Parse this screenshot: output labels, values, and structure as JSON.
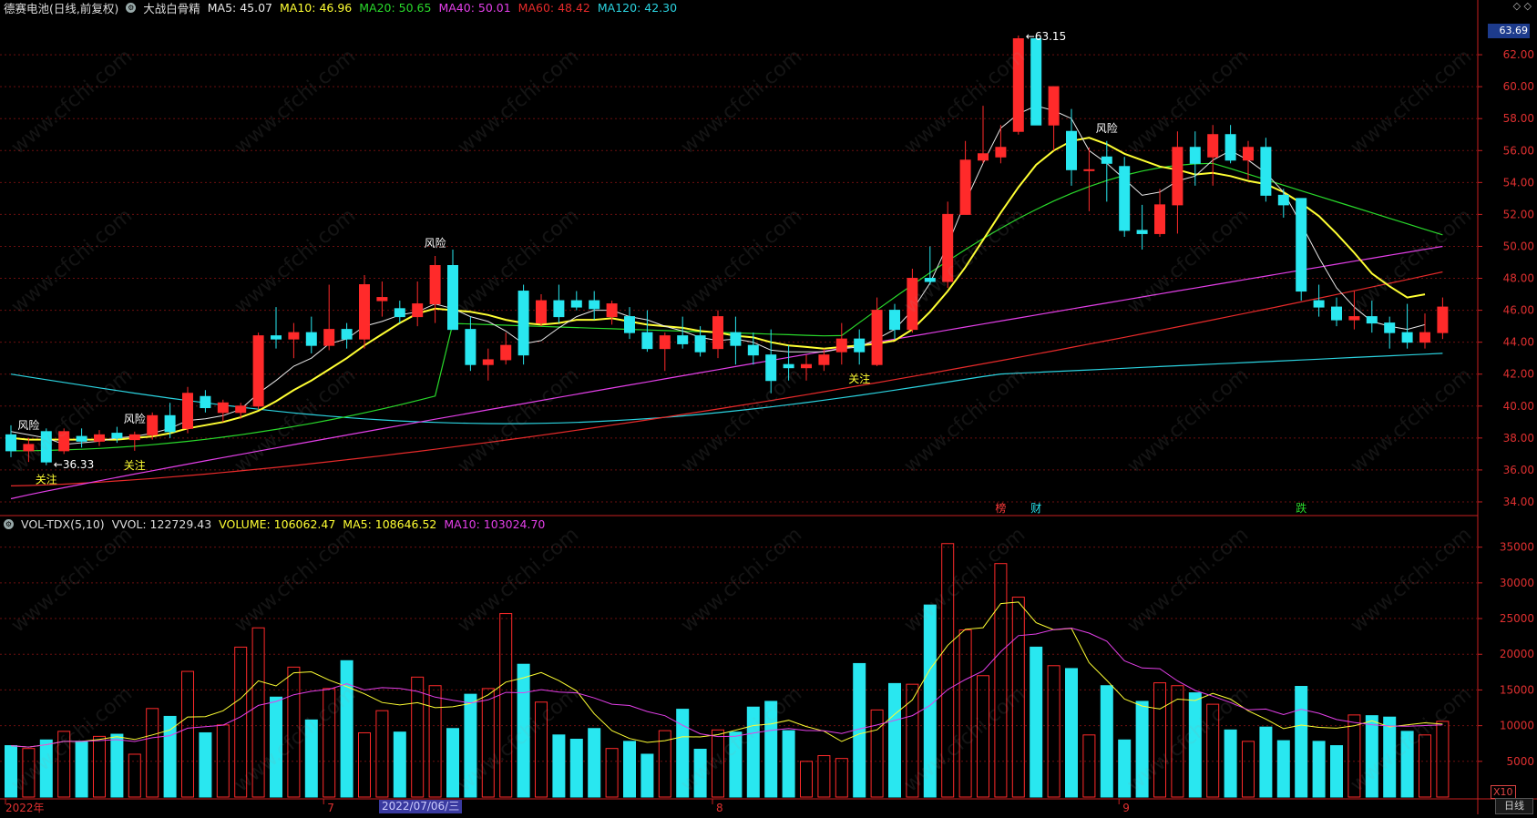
{
  "header": {
    "stock": "德赛电池(日线,前复权)",
    "indicator": "大战白骨精",
    "ma5": "MA5: 45.07",
    "ma10": "MA10: 46.96",
    "ma20": "MA20: 50.65",
    "ma40": "MA40: 50.01",
    "ma60": "MA60: 48.42",
    "ma120": "MA120: 42.30"
  },
  "vol_header": {
    "name": "VOL-TDX(5,10)",
    "vvol": "VVOL: 122729.43",
    "volume": "VOLUME: 106062.47",
    "ma5": "MA5: 108646.52",
    "ma10": "MA10: 103024.70"
  },
  "colors": {
    "up": "#ff2a2a",
    "down": "#29e7f0",
    "ma5": "#e8e8e8",
    "ma10": "#ffff33",
    "ma20": "#29d92b",
    "ma40": "#e33fe8",
    "ma60": "#e62a2a",
    "ma120": "#2bd3e0",
    "grid": "#6b0f0f",
    "axis": "#c82020",
    "signal_risk": "#ffffff",
    "signal_focus": "#ffff33"
  },
  "price_tag": "63.69",
  "timeframe": "日线",
  "vol_scale_note": "X10",
  "selected_date": "2022/07/06/三",
  "corner_icons": "◇ ◇",
  "chart_data": {
    "type": "candlestick",
    "price_axis": {
      "ticks": [
        34,
        36,
        38,
        40,
        42,
        44,
        46,
        48,
        50,
        52,
        54,
        56,
        58,
        60,
        62
      ],
      "labels": [
        "34.00",
        "36.00",
        "38.00",
        "40.00",
        "42.00",
        "44.00",
        "46.00",
        "48.00",
        "50.00",
        "52.00",
        "54.00",
        "56.00",
        "58.00",
        "60.00",
        "62.00"
      ],
      "range": [
        33.2,
        64.4
      ]
    },
    "vol_axis": {
      "ticks": [
        5000,
        10000,
        15000,
        20000,
        25000,
        30000,
        35000
      ],
      "range": [
        0,
        37000
      ]
    },
    "x_labels": [
      {
        "i": 0,
        "text": "2022年"
      },
      {
        "i": 18,
        "text": "7"
      },
      {
        "i": 40,
        "text": "8"
      },
      {
        "i": 63,
        "text": "9"
      }
    ],
    "candles": [
      [
        38.2,
        38.8,
        36.8,
        37.2,
        7200
      ],
      [
        37.2,
        38.0,
        36.5,
        37.6,
        6800
      ],
      [
        38.4,
        38.6,
        36.3,
        36.5,
        8000
      ],
      [
        37.2,
        38.6,
        37.0,
        38.4,
        9200
      ],
      [
        38.1,
        38.6,
        37.4,
        37.8,
        7800
      ],
      [
        37.8,
        38.5,
        37.5,
        38.2,
        8500
      ],
      [
        38.3,
        38.7,
        37.7,
        38.0,
        8800
      ],
      [
        37.9,
        38.4,
        37.2,
        38.2,
        6000
      ],
      [
        38.2,
        39.6,
        37.9,
        39.4,
        12400
      ],
      [
        39.4,
        40.2,
        38.0,
        38.4,
        11300
      ],
      [
        38.6,
        41.2,
        38.3,
        40.8,
        17600
      ],
      [
        40.6,
        41.0,
        39.6,
        39.9,
        9000
      ],
      [
        39.6,
        40.4,
        39.0,
        40.2,
        10100
      ],
      [
        39.6,
        40.2,
        39.2,
        40.0,
        21000
      ],
      [
        40.0,
        44.6,
        39.8,
        44.4,
        23700
      ],
      [
        44.4,
        46.2,
        43.6,
        44.2,
        14000
      ],
      [
        44.2,
        45.2,
        43.0,
        44.6,
        18200
      ],
      [
        44.6,
        45.6,
        43.3,
        43.8,
        10800
      ],
      [
        43.8,
        47.6,
        43.5,
        44.8,
        15200
      ],
      [
        44.8,
        45.2,
        43.6,
        44.2,
        19100
      ],
      [
        44.2,
        48.2,
        43.6,
        47.6,
        9000
      ],
      [
        46.6,
        47.8,
        45.6,
        46.8,
        12100
      ],
      [
        46.1,
        46.6,
        45.2,
        45.6,
        9100
      ],
      [
        45.6,
        47.8,
        45.0,
        46.4,
        16800
      ],
      [
        46.4,
        49.4,
        45.2,
        48.8,
        15600
      ],
      [
        48.8,
        49.8,
        44.8,
        44.8,
        9600
      ],
      [
        44.8,
        45.6,
        42.2,
        42.6,
        14400
      ],
      [
        42.6,
        43.6,
        41.6,
        42.9,
        15200
      ],
      [
        42.9,
        44.6,
        42.6,
        43.8,
        25700
      ],
      [
        47.2,
        47.6,
        42.6,
        43.2,
        18600
      ],
      [
        45.2,
        47.0,
        45.0,
        46.6,
        13300
      ],
      [
        46.6,
        47.6,
        45.2,
        45.6,
        8700
      ],
      [
        46.6,
        47.2,
        46.0,
        46.2,
        8100
      ],
      [
        46.6,
        47.2,
        45.4,
        46.1,
        9600
      ],
      [
        45.6,
        46.6,
        45.1,
        46.4,
        6800
      ],
      [
        45.6,
        46.2,
        44.2,
        44.6,
        7800
      ],
      [
        44.6,
        46.0,
        43.4,
        43.6,
        6000
      ],
      [
        43.6,
        44.6,
        42.2,
        44.4,
        9300
      ],
      [
        44.4,
        45.6,
        43.6,
        43.9,
        12300
      ],
      [
        44.4,
        45.0,
        43.1,
        43.4,
        6700
      ],
      [
        43.6,
        46.0,
        43.0,
        45.6,
        9400
      ],
      [
        44.6,
        45.6,
        42.6,
        43.8,
        9100
      ],
      [
        43.8,
        44.6,
        42.6,
        43.2,
        12600
      ],
      [
        43.2,
        44.8,
        40.8,
        41.6,
        13400
      ],
      [
        42.6,
        43.8,
        41.6,
        42.4,
        9300
      ],
      [
        42.4,
        43.2,
        41.6,
        42.6,
        5000
      ],
      [
        42.6,
        43.6,
        42.2,
        43.2,
        5800
      ],
      [
        43.4,
        45.2,
        42.6,
        44.2,
        5400
      ],
      [
        44.2,
        44.8,
        42.6,
        43.4,
        18700
      ],
      [
        42.6,
        46.8,
        42.5,
        46.0,
        12200
      ],
      [
        46.0,
        46.4,
        44.2,
        44.8,
        15900
      ],
      [
        44.8,
        48.6,
        44.6,
        48.0,
        15800
      ],
      [
        48.0,
        50.0,
        47.6,
        47.8,
        26900
      ],
      [
        47.8,
        52.8,
        47.4,
        52.0,
        35500
      ],
      [
        52.0,
        56.6,
        52.0,
        55.4,
        23400
      ],
      [
        55.4,
        58.8,
        55.2,
        55.8,
        17000
      ],
      [
        55.6,
        57.6,
        55.2,
        56.2,
        32700
      ],
      [
        57.2,
        63.2,
        57.0,
        63.0,
        28000
      ],
      [
        63.0,
        63.2,
        57.6,
        57.6,
        21000
      ],
      [
        57.6,
        60.0,
        56.0,
        60.0,
        18400
      ],
      [
        57.2,
        58.6,
        53.8,
        54.8,
        18000
      ],
      [
        54.8,
        56.2,
        52.2,
        54.8,
        8700
      ],
      [
        55.6,
        56.6,
        52.8,
        55.2,
        15600
      ],
      [
        55.0,
        55.6,
        50.6,
        51.0,
        8000
      ],
      [
        51.0,
        52.6,
        49.8,
        50.8,
        13400
      ],
      [
        50.8,
        53.6,
        50.6,
        52.6,
        16000
      ],
      [
        52.6,
        57.2,
        50.8,
        56.2,
        15600
      ],
      [
        56.2,
        57.2,
        53.8,
        55.2,
        14600
      ],
      [
        55.6,
        57.6,
        53.8,
        57.0,
        13000
      ],
      [
        57.0,
        57.6,
        55.2,
        55.4,
        9400
      ],
      [
        55.4,
        56.6,
        54.2,
        56.2,
        7800
      ],
      [
        56.2,
        56.8,
        52.8,
        53.2,
        9800
      ],
      [
        53.2,
        53.6,
        51.8,
        52.6,
        7900
      ],
      [
        53.0,
        53.0,
        46.6,
        47.2,
        15500
      ],
      [
        46.6,
        47.6,
        45.6,
        46.2,
        7800
      ],
      [
        46.2,
        46.8,
        45.0,
        45.4,
        7200
      ],
      [
        45.4,
        47.2,
        44.8,
        45.6,
        11500
      ],
      [
        45.6,
        46.6,
        44.6,
        45.2,
        11400
      ],
      [
        45.2,
        45.6,
        43.6,
        44.6,
        11200
      ],
      [
        44.6,
        46.4,
        43.6,
        44.0,
        9200
      ],
      [
        44.0,
        45.8,
        43.6,
        44.6,
        8700
      ],
      [
        44.6,
        46.8,
        44.2,
        46.2,
        10600
      ]
    ],
    "ma_lines": {
      "ma5": [
        38.4,
        38.2,
        38.0,
        37.6,
        37.7,
        37.8,
        38.0,
        38.1,
        38.3,
        38.6,
        39.1,
        39.2,
        39.4,
        39.8,
        40.8,
        41.6,
        42.5,
        43.0,
        43.9,
        44.2,
        45.0,
        45.3,
        45.7,
        45.9,
        46.4,
        46.1,
        45.6,
        45.3,
        44.7,
        43.9,
        44.1,
        44.9,
        45.6,
        46.0,
        46.0,
        45.6,
        45.4,
        45.0,
        44.7,
        44.3,
        44.1,
        44.2,
        44.0,
        43.5,
        43.4,
        43.4,
        43.4,
        43.6,
        43.7,
        44.2,
        44.8,
        46.0,
        47.7,
        50.1,
        52.8,
        55.2,
        57.4,
        58.3,
        58.8,
        58.5,
        58.0,
        56.0,
        55.2,
        54.2,
        53.2,
        53.4,
        54.1,
        54.4,
        55.4,
        56.0,
        55.4,
        54.6,
        53.4,
        51.4,
        49.3,
        47.4,
        46.2,
        45.3,
        45.0,
        44.8,
        45.1
      ],
      "ma10": [
        38.0,
        37.9,
        37.9,
        37.9,
        37.9,
        37.9,
        37.9,
        38.0,
        38.1,
        38.3,
        38.6,
        38.8,
        39.0,
        39.3,
        39.7,
        40.3,
        41.0,
        41.6,
        42.3,
        43.0,
        43.8,
        44.5,
        45.2,
        45.8,
        46.1,
        46.0,
        45.9,
        45.7,
        45.4,
        45.2,
        45.1,
        45.2,
        45.4,
        45.4,
        45.5,
        45.3,
        45.1,
        45.0,
        44.9,
        44.7,
        44.6,
        44.4,
        44.3,
        44.0,
        43.8,
        43.7,
        43.6,
        43.7,
        43.8,
        43.9,
        44.1,
        44.8,
        45.9,
        47.2,
        48.7,
        50.4,
        52.1,
        53.7,
        55.1,
        56.0,
        56.6,
        56.8,
        56.4,
        55.8,
        55.4,
        55.0,
        54.8,
        54.5,
        54.6,
        54.4,
        54.1,
        53.9,
        53.4,
        52.7,
        51.9,
        50.8,
        49.6,
        48.3,
        47.5,
        46.8,
        47.0
      ]
    },
    "signals": [
      {
        "i": 1,
        "text": "风险",
        "pos": "above"
      },
      {
        "i": 2,
        "text": "关注",
        "pos": "below"
      },
      {
        "i": 7,
        "text": "风险",
        "pos": "above"
      },
      {
        "i": 7,
        "text": "关注",
        "pos": "below"
      },
      {
        "i": 24,
        "text": "风险",
        "pos": "above"
      },
      {
        "i": 48,
        "text": "关注",
        "pos": "below"
      },
      {
        "i": 62,
        "text": "风险",
        "pos": "above"
      }
    ],
    "annotations": [
      {
        "i": 2,
        "price": 36.33,
        "text": "36.33"
      },
      {
        "i": 57,
        "price": 63.15,
        "text": "63.15"
      }
    ],
    "event_tags": [
      {
        "i": 56,
        "text": "榜",
        "color": "#ff3b3b"
      },
      {
        "i": 58,
        "text": "财",
        "color": "#29e7f0"
      },
      {
        "i": 73,
        "text": "跌",
        "color": "#29d92b"
      }
    ]
  }
}
